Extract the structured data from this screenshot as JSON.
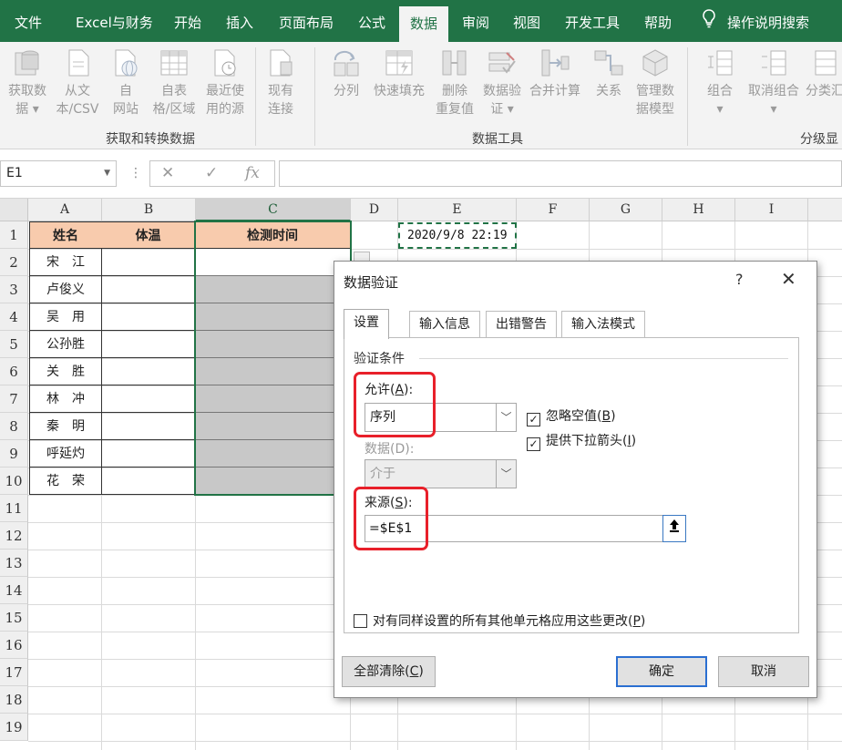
{
  "ribbon_tabs": [
    "文件",
    "Excel与财务",
    "开始",
    "插入",
    "页面布局",
    "公式",
    "数据",
    "审阅",
    "视图",
    "开发工具",
    "帮助",
    "操作说明搜索"
  ],
  "active_tab": "数据",
  "groups": {
    "get_transform": {
      "label": "获取和转换数据",
      "buttons": [
        {
          "l1": "获取数",
          "l2": "据 ▾"
        },
        {
          "l1": "从文",
          "l2": "本/CSV"
        },
        {
          "l1": "自",
          "l2": "网站"
        },
        {
          "l1": "自表",
          "l2": "格/区域"
        },
        {
          "l1": "最近使",
          "l2": "用的源"
        },
        {
          "l1": "现有",
          "l2": "连接"
        }
      ]
    },
    "data_tools": {
      "label": "数据工具",
      "buttons": [
        {
          "l1": "分列",
          "l2": ""
        },
        {
          "l1": "快速填充",
          "l2": ""
        },
        {
          "l1": "删除",
          "l2": "重复值"
        },
        {
          "l1": "数据验",
          "l2": "证 ▾"
        },
        {
          "l1": "合并计算",
          "l2": ""
        },
        {
          "l1": "关系",
          "l2": ""
        },
        {
          "l1": "管理数",
          "l2": "据模型"
        }
      ]
    },
    "outline": {
      "label": "分级显",
      "buttons": [
        {
          "l1": "组合",
          "l2": "▾"
        },
        {
          "l1": "取消组合",
          "l2": "▾"
        },
        {
          "l1": "分类汇",
          "l2": ""
        }
      ]
    }
  },
  "formula_bar": {
    "name_box": "E1",
    "cancel": "✕",
    "enter": "✓",
    "fx": "fx",
    "formula": ""
  },
  "sheet": {
    "columns": [
      "A",
      "B",
      "C",
      "D",
      "E",
      "F",
      "G",
      "H",
      "I"
    ],
    "rows": [
      "1",
      "2",
      "3",
      "4",
      "5",
      "6",
      "7",
      "8",
      "9",
      "10",
      "11",
      "12",
      "13",
      "14",
      "15",
      "16",
      "17",
      "18",
      "19"
    ],
    "headers": {
      "a": "姓名",
      "b": "体温",
      "c": "检测时间"
    },
    "names": [
      "宋　江",
      "卢俊义",
      "吴　用",
      "公孙胜",
      "关　胜",
      "林　冲",
      "秦　明",
      "呼延灼",
      "花　荣"
    ],
    "e1_value": "2020/9/8 22:19"
  },
  "dialog": {
    "title": "数据验证",
    "help": "?",
    "close": "✕",
    "tabs": [
      "设置",
      "输入信息",
      "出错警告",
      "输入法模式"
    ],
    "section": "验证条件",
    "allow_label": "允许(",
    "allow_key": "A",
    "allow_tail": "):",
    "allow_value": "序列",
    "ignore_blank_pre": "忽略空值(",
    "ignore_blank_key": "B",
    "ignore_blank_tail": ")",
    "dropdown_pre": "提供下拉箭头(",
    "dropdown_key": "I",
    "dropdown_tail": ")",
    "data_label": "数据(D):",
    "data_value": "介于",
    "source_label": "来源(",
    "source_key": "S",
    "source_tail": "):",
    "source_value": "=$E$1",
    "apply_all_pre": "对有同样设置的所有其他单元格应用这些更改(",
    "apply_all_key": "P",
    "apply_all_tail": ")",
    "clear_all_pre": "全部清除(",
    "clear_all_key": "C",
    "clear_all_tail": ")",
    "ok": "确定",
    "cancel": "取消"
  }
}
